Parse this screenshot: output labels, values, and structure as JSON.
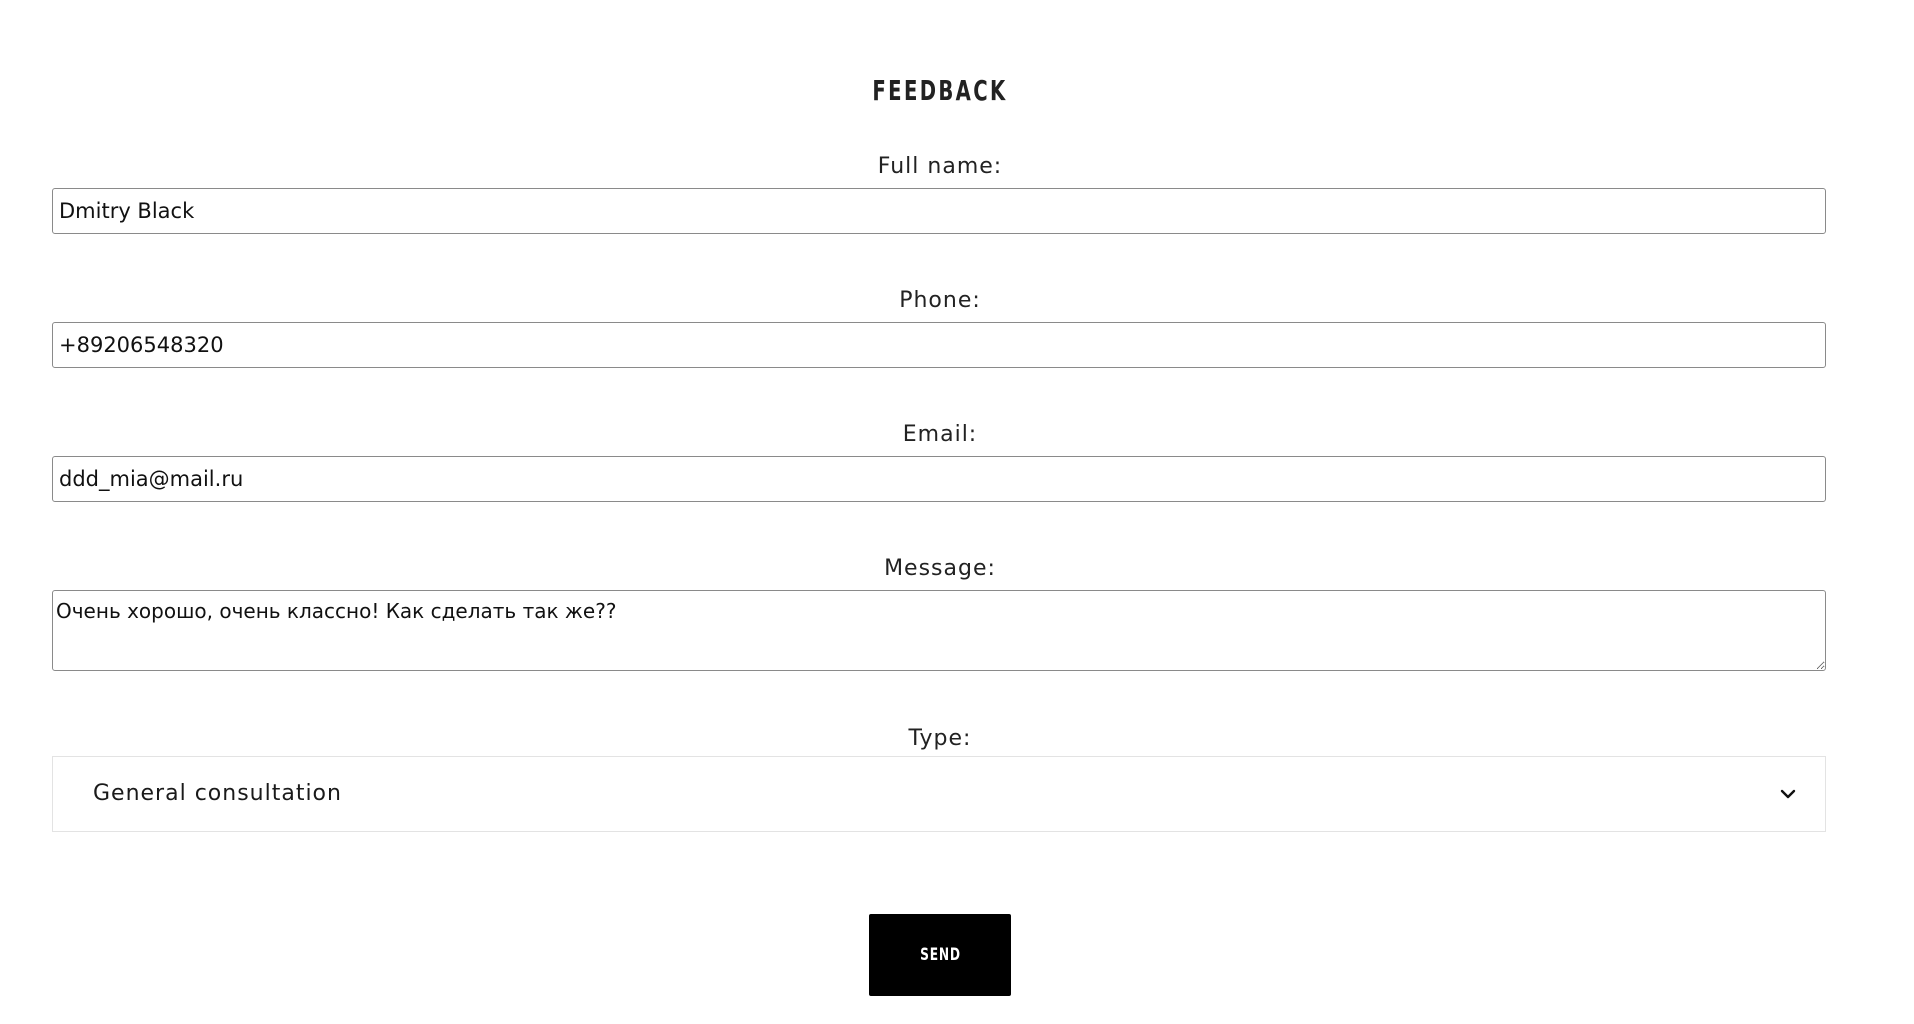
{
  "page": {
    "title": "FEEDBACK"
  },
  "form": {
    "full_name": {
      "label": "Full name:",
      "value": "Dmitry Black"
    },
    "phone": {
      "label": "Phone:",
      "value": "+89206548320"
    },
    "email": {
      "label": "Email:",
      "value": "ddd_mia@mail.ru"
    },
    "message": {
      "label": "Message:",
      "value": "Очень хорошо, очень классно! Как сделать так же??"
    },
    "type": {
      "label": "Type:",
      "selected": "General consultation",
      "icon": "chevron-down-icon"
    },
    "send_label": "SEND"
  },
  "colors": {
    "background": "#ffffff",
    "button_bg": "#000000",
    "button_text": "#ffffff",
    "field_border": "#8a8a8a",
    "select_border": "#e3e3e3"
  }
}
